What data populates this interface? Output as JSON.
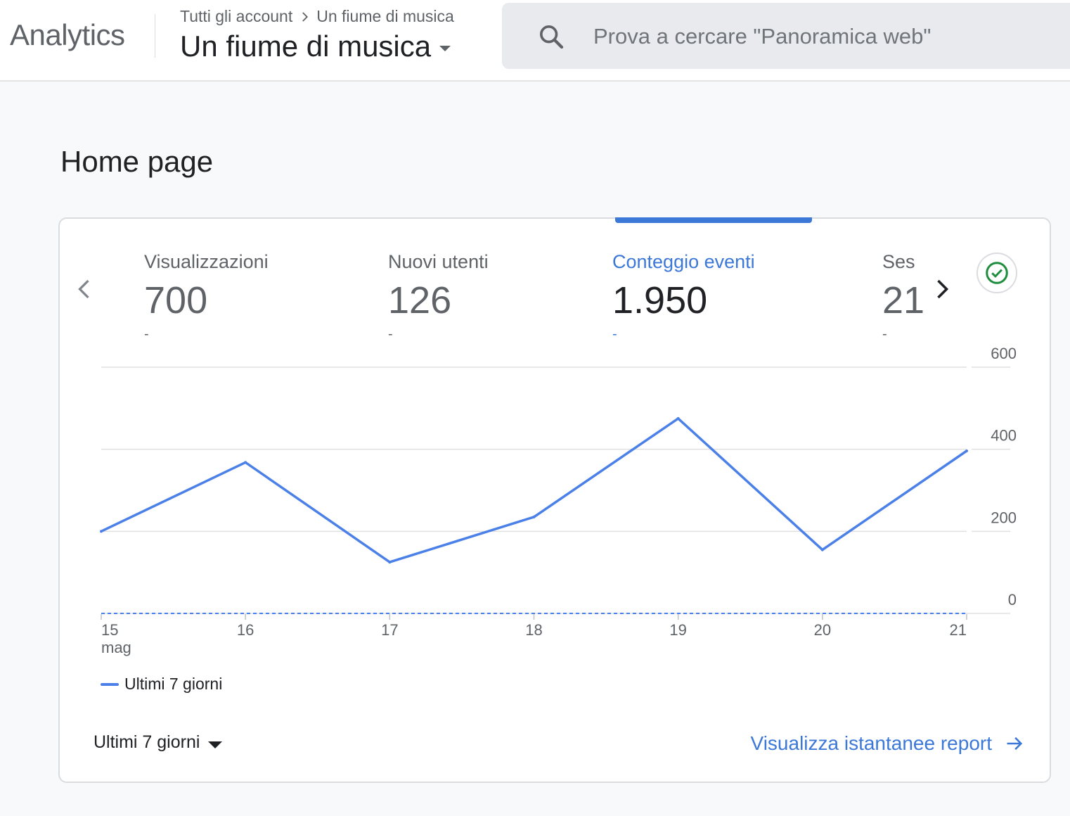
{
  "header": {
    "app_name": "Analytics",
    "breadcrumb": {
      "account": "Tutti gli account",
      "property": "Un fiume di musica"
    },
    "property_name": "Un fiume di musica",
    "search_placeholder": "Prova a cercare \"Panoramica web\""
  },
  "page": {
    "title": "Home page"
  },
  "metrics": [
    {
      "label": "Visualizzazioni",
      "value": "700",
      "change": "-",
      "active": false
    },
    {
      "label": "Nuovi utenti",
      "value": "126",
      "change": "-",
      "active": false
    },
    {
      "label": "Conteggio eventi",
      "value": "1.950",
      "change": "-",
      "active": true
    },
    {
      "label": "Ses",
      "value": "21",
      "change": "-",
      "active": false
    }
  ],
  "chart_data": {
    "type": "line",
    "x": [
      "15",
      "16",
      "17",
      "18",
      "19",
      "20",
      "21"
    ],
    "x_sublabel": "mag",
    "series": [
      {
        "name": "Ultimi 7 giorni",
        "values": [
          200,
          368,
          125,
          235,
          475,
          155,
          396
        ],
        "color": "#4a80e8"
      }
    ],
    "y_ticks": [
      "600",
      "400",
      "200",
      "0"
    ],
    "ylim": [
      0,
      600
    ],
    "grid": true,
    "legend": "bottom-left"
  },
  "footer": {
    "range_label": "Ultimi 7 giorni",
    "report_link": "Visualizza istantanee report"
  },
  "colors": {
    "accent": "#3c78d8",
    "line": "#4a80e8",
    "success": "#1e8e3e"
  }
}
